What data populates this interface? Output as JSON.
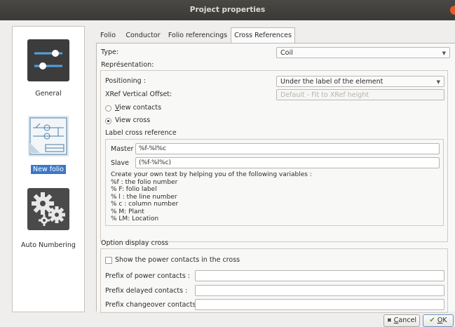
{
  "window": {
    "title": "Project properties"
  },
  "sidebar": {
    "items": [
      {
        "label": "General",
        "icon": "sliders-icon",
        "selected": false
      },
      {
        "label": "New folio",
        "icon": "folio-schematic-icon",
        "selected": true
      },
      {
        "label": "Auto Numbering",
        "icon": "gears-icon",
        "selected": false
      }
    ]
  },
  "tabs": [
    {
      "label": "Folio",
      "active": false
    },
    {
      "label": "Conductor",
      "active": false
    },
    {
      "label": "Folio referencings",
      "active": false
    },
    {
      "label": "Cross References",
      "active": true
    }
  ],
  "type": {
    "label": "Type:",
    "value": "Coil"
  },
  "representation": {
    "label": "Représentation:",
    "positioning": {
      "label": "Positioning :",
      "value": "Under the label of the element"
    },
    "vertical_offset": {
      "label": "XRef Vertical Offset:",
      "value": "Default - Fit to XRef height"
    },
    "view_contacts": {
      "prefix": "",
      "mnemonic": "V",
      "rest": "iew contacts",
      "checked": false
    },
    "view_cross": {
      "label": "View cross",
      "checked": true
    },
    "label_cross_reference": {
      "label": "Label cross reference",
      "master_label": "Master",
      "master_value": "%f-%l%c",
      "slave_label": "Slave",
      "slave_value": "(%f-%l%c)",
      "help_text": "Create your own text by helping you of the following variables :\n%f : the folio number\n% F: folio label\n% l : the line number\n% c : column number\n% M: Plant\n% LM: Location"
    }
  },
  "option_display_cross": {
    "label": "Option display cross",
    "show_power_contacts": {
      "label": "Show the power contacts in the cross",
      "checked": false
    },
    "prefix_power": {
      "label": "Prefix of power contacts :",
      "value": ""
    },
    "prefix_delayed": {
      "label": "Prefix delayed contacts :",
      "value": ""
    },
    "prefix_changeover": {
      "label": "Prefix changeover contacts :",
      "value": ""
    }
  },
  "buttons": {
    "cancel": {
      "prefix": "",
      "mnemonic": "C",
      "rest": "ancel"
    },
    "ok": {
      "prefix": "",
      "mnemonic": "O",
      "rest": "K"
    }
  },
  "colors": {
    "accent": "#3a78c6",
    "titlebar": "#3e3d3a",
    "close": "#e8582a"
  }
}
